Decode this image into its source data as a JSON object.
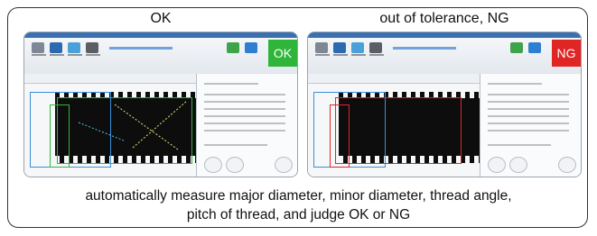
{
  "panels": [
    {
      "label": "OK",
      "status_text": "OK",
      "status_color": "#2fb63a"
    },
    {
      "label": "out of tolerance, NG",
      "status_text": "NG",
      "status_color": "#e02525"
    }
  ],
  "caption": {
    "line1": "automatically measure major diameter, minor diameter, thread angle,",
    "line2": "pitch of thread, and judge OK or NG"
  },
  "colors": {
    "measure_blue": "#3b8fd8",
    "measure_green": "#2fb63a",
    "measure_red": "#e02525"
  },
  "icons": [
    "app-ribbon-icons"
  ]
}
